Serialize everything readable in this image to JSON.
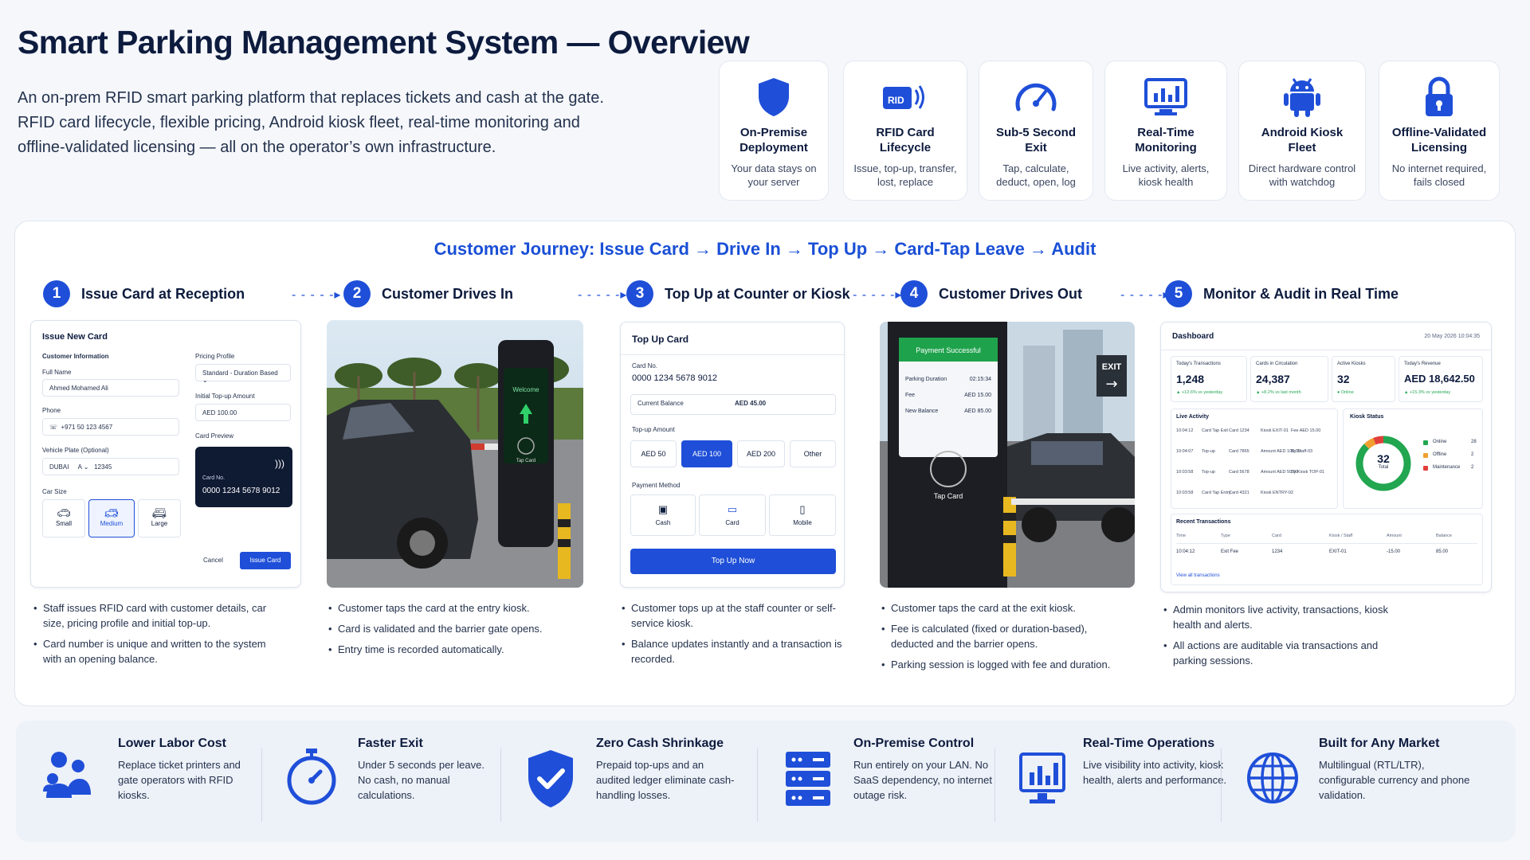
{
  "header": {
    "title": "Smart Parking Management System — Overview",
    "intro": "An on-prem RFID smart parking platform that replaces tickets and cash at the gate. RFID card lifecycle, flexible pricing, Android kiosk fleet, real-time monitoring and offline-validated licensing — all on the operator’s own infrastructure."
  },
  "features": [
    {
      "icon": "shield-icon",
      "title": "On-Premise Deployment",
      "desc": "Your data stays on your server"
    },
    {
      "icon": "rfid-card-icon",
      "title": "RFID Card Lifecycle",
      "desc": "Issue, top-up, transfer, lost, replace"
    },
    {
      "icon": "gauge-icon",
      "title": "Sub-5 Second Exit",
      "desc": "Tap, calculate, deduct, open, log"
    },
    {
      "icon": "monitor-icon",
      "title": "Real-Time Monitoring",
      "desc": "Live activity, alerts, kiosk health"
    },
    {
      "icon": "android-icon",
      "title": "Android Kiosk Fleet",
      "desc": "Direct hardware control with watchdog"
    },
    {
      "icon": "lock-icon",
      "title": "Offline-Validated Licensing",
      "desc": "No internet required, fails closed"
    }
  ],
  "journey": {
    "title": "Customer Journey: Issue Card → Drive In → Top Up → Card-Tap Leave → Audit",
    "steps": [
      {
        "num": "1",
        "title": "Issue Card at Reception",
        "bullets": [
          "Staff issues RFID card with customer details, car size, pricing profile and initial top-up.",
          "Card number is unique and written to the system with an opening balance."
        ]
      },
      {
        "num": "2",
        "title": "Customer Drives In",
        "bullets": [
          "Customer taps the card at the entry kiosk.",
          "Card is validated and the barrier gate opens.",
          "Entry time is recorded automatically."
        ]
      },
      {
        "num": "3",
        "title": "Top Up at Counter or Kiosk",
        "bullets": [
          "Customer tops up at the staff counter or self-service kiosk.",
          "Balance updates instantly and a transaction is recorded."
        ]
      },
      {
        "num": "4",
        "title": "Customer Drives Out",
        "bullets": [
          "Customer taps the card at the exit kiosk.",
          "Fee is calculated (fixed or duration-based), deducted and the barrier opens.",
          "Parking session is logged with fee and duration."
        ]
      },
      {
        "num": "5",
        "title": "Monitor & Audit in Real Time",
        "bullets": [
          "Admin monitors live activity, transactions, kiosk health and alerts.",
          "All actions are auditable via transactions and parking sessions."
        ]
      }
    ]
  },
  "issue_form": {
    "title": "Issue New Card",
    "section": "Customer Information",
    "full_name_label": "Full Name",
    "full_name": "Ahmed Mohamed Ali",
    "phone_label": "Phone",
    "phone_cc": "☏",
    "phone": "+971 50 123 4567",
    "plate_label": "Vehicle Plate (Optional)",
    "plate_city": "DUBAI",
    "plate_code": "A",
    "plate_num": "12345",
    "car_size_label": "Car Size",
    "sizes": [
      "Small",
      "Medium",
      "Large"
    ],
    "selected_size": "Medium",
    "pricing_label": "Pricing Profile",
    "pricing": "Standard - Duration Based",
    "topup_label": "Initial Top-up Amount",
    "topup": "AED 100.00",
    "preview_label": "Card Preview",
    "card_no_label": "Card No.",
    "card_no": "0000 1234 5678 9012",
    "cancel": "Cancel",
    "issue": "Issue Card"
  },
  "entry_kiosk": {
    "welcome": "Welcome",
    "tap": "Tap Card"
  },
  "topup_form": {
    "title": "Top Up Card",
    "card_no_label": "Card No.",
    "card_no": "0000 1234 5678 9012",
    "balance_label": "Current Balance",
    "balance": "AED 45.00",
    "amount_label": "Top-up Amount",
    "amounts": [
      "AED 50",
      "AED 100",
      "AED 200",
      "Other"
    ],
    "selected_amount": "AED 100",
    "method_label": "Payment Method",
    "methods": [
      "Cash",
      "Card",
      "Mobile"
    ],
    "submit": "Top Up Now"
  },
  "exit_kiosk": {
    "success": "Payment Successful",
    "rows": [
      {
        "k": "Parking Duration",
        "v": "02:15:34"
      },
      {
        "k": "Fee",
        "v": "AED 15.00"
      },
      {
        "k": "New Balance",
        "v": "AED 85.00"
      }
    ],
    "tap": "Tap Card",
    "sign": "EXIT"
  },
  "dashboard": {
    "title": "Dashboard",
    "date": "20 May 2026  10:04:35",
    "stats": [
      {
        "label": "Today's Transactions",
        "value": "1,248",
        "delta": "▲ +12.6% vs yesterday"
      },
      {
        "label": "Cards in Circulation",
        "value": "24,387",
        "delta": "▲ +8.2% vs last month"
      },
      {
        "label": "Active Kiosks",
        "value": "32",
        "delta": "● Online"
      },
      {
        "label": "Today's Revenue",
        "value": "AED 18,642.50",
        "delta": "▲ +15.3% vs yesterday"
      }
    ],
    "live_title": "Live Activity",
    "live": [
      {
        "t": "10:04:12",
        "e": "Card Tap Exit",
        "c": "Card 1234",
        "k": "Kiosk EXIT-01",
        "f": "Fee AED 15.00"
      },
      {
        "t": "10:04:07",
        "e": "Top-up",
        "c": "Card 7865",
        "k": "Amount AED 100.00",
        "f": "By Staff-03"
      },
      {
        "t": "10:03:58",
        "e": "Top-up",
        "c": "Card 5678",
        "k": "Amount AED 50.00",
        "f": "By Kiosk TOP-01"
      },
      {
        "t": "10:03:58",
        "e": "Card Tap Entry",
        "c": "Card 4321",
        "k": "Kiosk ENTRY-02",
        "f": ""
      }
    ],
    "kiosk_title": "Kiosk Status",
    "kiosk_total": "32",
    "kiosk_total_label": "Total",
    "kiosk_legend": [
      {
        "name": "Online",
        "value": 28,
        "color": "#22a650"
      },
      {
        "name": "Offline",
        "value": 2,
        "color": "#f0a030"
      },
      {
        "name": "Maintenance",
        "value": 2,
        "color": "#e0403a"
      }
    ],
    "recent_title": "Recent Transactions",
    "recent_headers": [
      "Time",
      "Type",
      "Card",
      "Kiosk / Staff",
      "Amount",
      "Balance"
    ],
    "recent_row": [
      "10:04:12",
      "Exit Fee",
      "1234",
      "EXIT-01",
      "-15.00",
      "85.00"
    ],
    "view_all": "View all transactions"
  },
  "benefits": [
    {
      "icon": "users-icon",
      "title": "Lower Labor Cost",
      "desc": "Replace ticket printers and gate operators with RFID kiosks."
    },
    {
      "icon": "stopwatch-icon",
      "title": "Faster Exit",
      "desc": "Under 5 seconds per leave. No cash, no manual calculations."
    },
    {
      "icon": "shield-check-icon",
      "title": "Zero Cash Shrinkage",
      "desc": "Prepaid top-ups and an audited ledger eliminate cash-handling losses."
    },
    {
      "icon": "server-icon",
      "title": "On-Premise Control",
      "desc": "Run entirely on your LAN. No SaaS dependency, no internet outage risk."
    },
    {
      "icon": "chart-monitor-icon",
      "title": "Real-Time Operations",
      "desc": "Live visibility into activity, kiosk health, alerts and performance."
    },
    {
      "icon": "globe-icon",
      "title": "Built for Any Market",
      "desc": "Multilingual (RTL/LTR), configurable currency and phone validation."
    }
  ],
  "colors": {
    "brand": "#1f4fd8",
    "navy": "#0d1b3e",
    "success": "#22a650"
  }
}
